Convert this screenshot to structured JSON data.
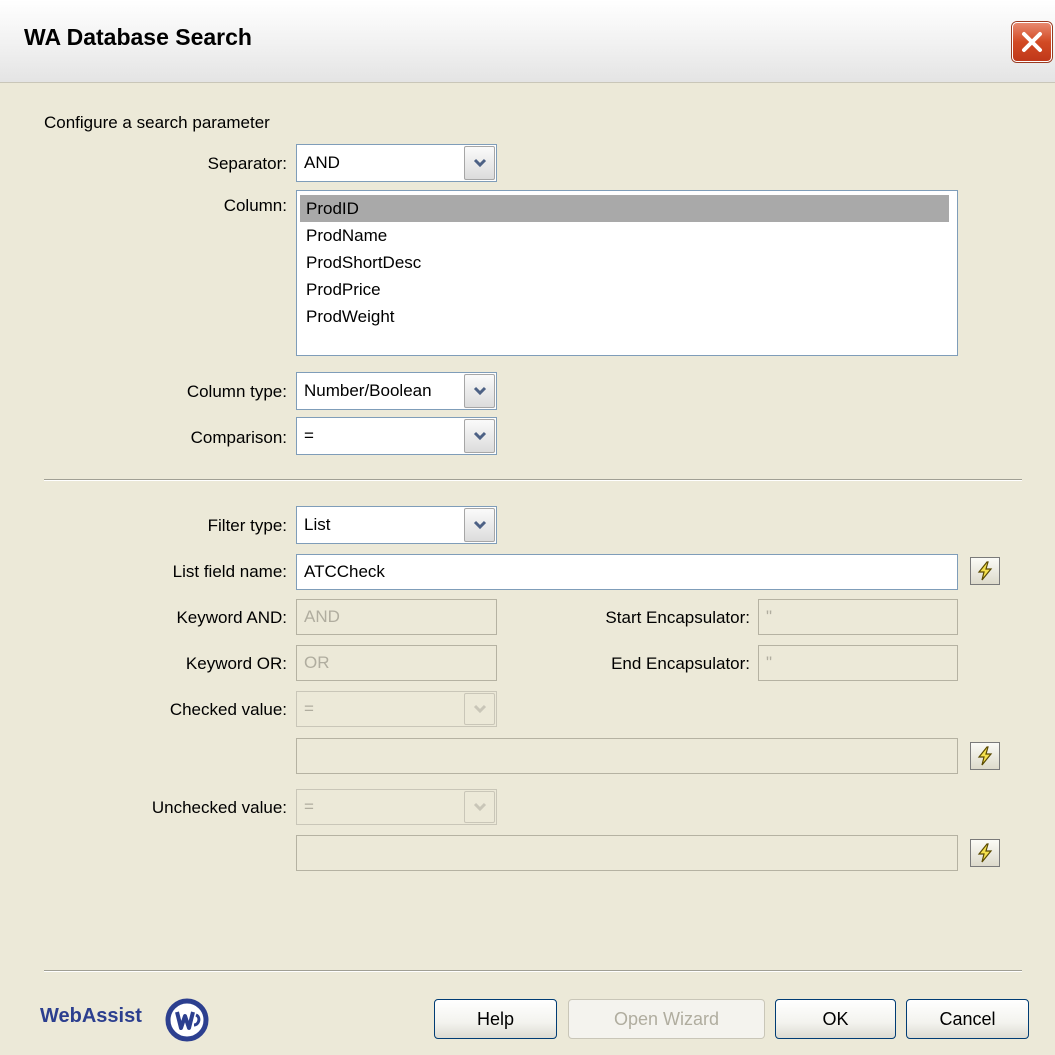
{
  "window": {
    "title": "WA Database Search"
  },
  "section_title": "Configure a search parameter",
  "separator": {
    "label": "Separator:",
    "value": "AND"
  },
  "column": {
    "label": "Column:",
    "items": [
      "ProdID",
      "ProdName",
      "ProdShortDesc",
      "ProdPrice",
      "ProdWeight"
    ],
    "selected": "ProdID"
  },
  "column_type": {
    "label": "Column type:",
    "value": "Number/Boolean"
  },
  "comparison": {
    "label": "Comparison:",
    "value": "="
  },
  "filter_type": {
    "label": "Filter type:",
    "value": "List"
  },
  "list_field_name": {
    "label": "List field name:",
    "value": "ATCCheck"
  },
  "keyword_and": {
    "label": "Keyword AND:",
    "value": "AND"
  },
  "keyword_or": {
    "label": "Keyword OR:",
    "value": "OR"
  },
  "start_encapsulator": {
    "label": "Start Encapsulator:",
    "value": "\""
  },
  "end_encapsulator": {
    "label": "End Encapsulator:",
    "value": "\""
  },
  "checked_value": {
    "label": "Checked value:",
    "comparison": "=",
    "value": ""
  },
  "unchecked_value": {
    "label": "Unchecked value:",
    "comparison": "=",
    "value": ""
  },
  "footer": {
    "logo_text": "WebAssist",
    "help_label": "Help",
    "open_wizard_label": "Open Wizard",
    "ok_label": "OK",
    "cancel_label": "Cancel"
  },
  "icons": {
    "dropdown": "chevron-down-icon",
    "dynamic": "lightning-bolt-icon",
    "close": "close-icon",
    "logo": "webassist-logo"
  }
}
